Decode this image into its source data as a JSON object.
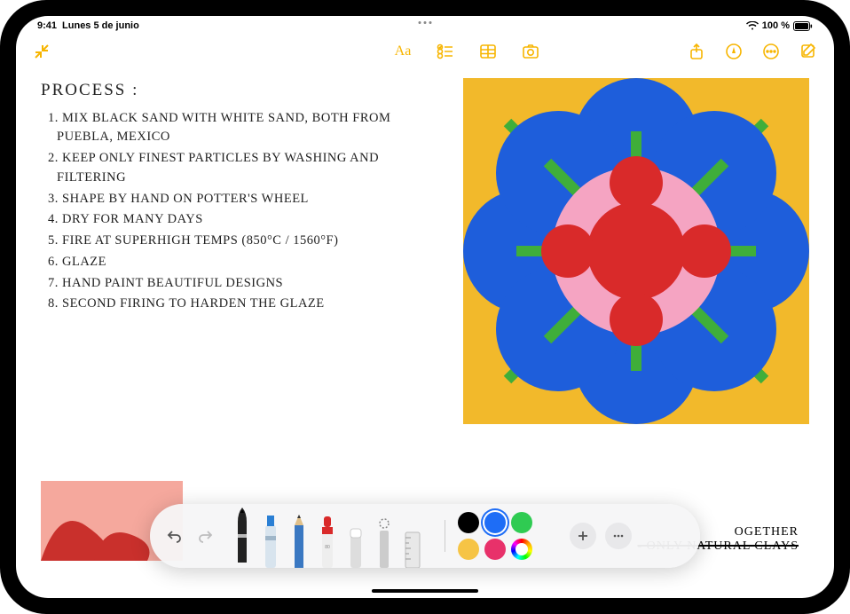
{
  "status": {
    "time": "9:41",
    "date": "Lunes 5 de junio",
    "battery": "100 %"
  },
  "toolbar": {
    "collapse": "collapse",
    "format": "Aa",
    "checklist": "checklist",
    "table": "table",
    "camera": "camera",
    "share": "share",
    "lock": "lock",
    "more": "more",
    "compose": "compose"
  },
  "note": {
    "title": "PROCESS :",
    "lines": [
      "1. MIX BLACK SAND WITH WHITE SAND, BOTH FROM PUEBLA, MEXICO",
      "2. KEEP ONLY FINEST PARTICLES BY WASHING AND FILTERING",
      "3. SHAPE BY HAND ON POTTER'S WHEEL",
      "4. DRY FOR MANY DAYS",
      "5. FIRE AT SUPERHIGH TEMPS (850°C / 1560°F)",
      "6. GLAZE",
      "7. HAND PAINT BEAUTIFUL DESIGNS",
      "8. SECOND FIRING TO HARDEN THE GLAZE"
    ]
  },
  "bottom_handwriting": {
    "line1": "OGETHER",
    "line2": "- ONLY NATURAL CLAYS"
  },
  "markup": {
    "tools": [
      "pen",
      "marker",
      "pencil",
      "brush",
      "eraser",
      "lasso",
      "ruler"
    ],
    "colors": {
      "r1": [
        "#000000",
        "#1E6DF6",
        "#2FCB52"
      ],
      "r2": [
        "#F6C445",
        "#E8316A",
        "#F2746B"
      ]
    }
  },
  "drawing": {
    "bg": "#f2b92b",
    "flower": "#1E5EDB",
    "center_outer": "#F5A4C2",
    "center_mid": "#D92A2A",
    "stems": "#3FAE3A"
  }
}
